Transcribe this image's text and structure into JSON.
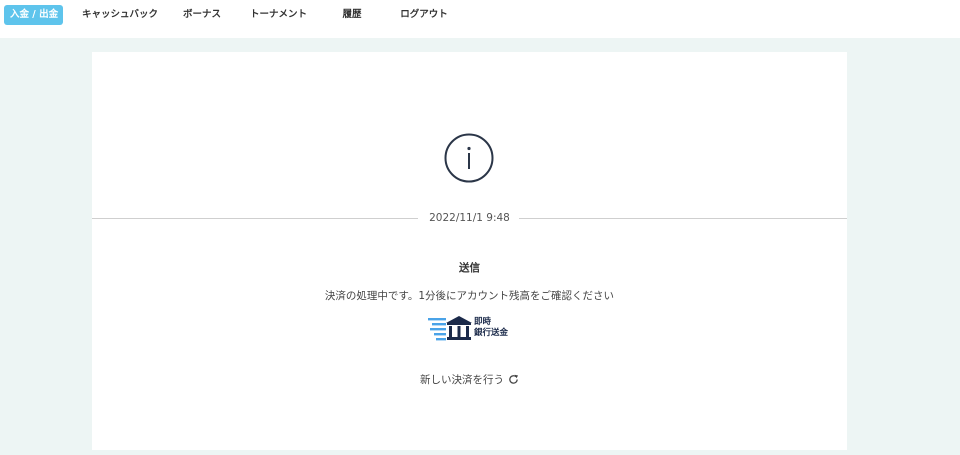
{
  "nav": {
    "items": [
      {
        "label": "入金 / 出金",
        "active": true
      },
      {
        "label": "キャッシュバック",
        "active": false
      },
      {
        "label": "ボーナス",
        "active": false
      },
      {
        "label": "トーナメント",
        "active": false
      },
      {
        "label": "履歴",
        "active": false
      },
      {
        "label": "ログアウト",
        "active": false
      }
    ]
  },
  "status": {
    "icon": "info-icon",
    "timestamp": "2022/11/1 9:48",
    "title": "送信",
    "message": "決済の処理中です。1分後にアカウント残高をご確認ください"
  },
  "payment_method": {
    "icon": "bank-icon",
    "line1": "即時",
    "line2": "銀行送金"
  },
  "actions": {
    "new_payment_label": "新しい決済を行う",
    "new_payment_icon": "refresh-icon"
  },
  "colors": {
    "accent": "#5ec4ec",
    "background": "#edf5f4",
    "icon_dark": "#2b3648",
    "logo_blue": "#4aa3e8"
  }
}
